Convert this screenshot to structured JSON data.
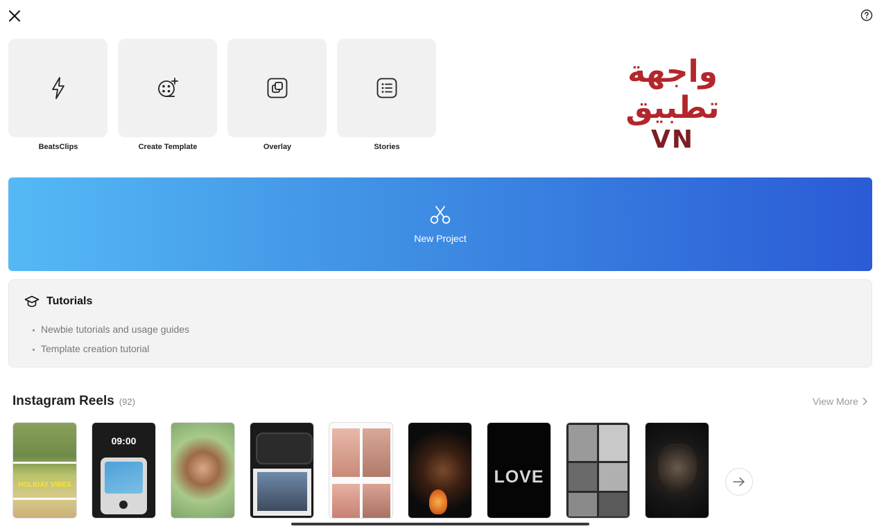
{
  "tiles": [
    {
      "label": "BeatsClips",
      "icon": "lightning-icon"
    },
    {
      "label": "Create Template",
      "icon": "film-reel-plus-icon"
    },
    {
      "label": "Overlay",
      "icon": "overlay-layers-icon"
    },
    {
      "label": "Stories",
      "icon": "list-icon"
    }
  ],
  "brand": {
    "arabic": "واجهة تطبيق",
    "latin": "VN"
  },
  "new_project": {
    "label": "New Project",
    "icon": "scissors-icon"
  },
  "tutorials": {
    "title": "Tutorials",
    "icon": "graduation-cap-icon",
    "items": [
      "Newbie tutorials and usage guides",
      "Template creation tutorial"
    ]
  },
  "reels": {
    "title": "Instagram Reels",
    "count": "(92)",
    "view_more": "View More",
    "thumb_texts": {
      "holiday": "HOLIDAY VIBES",
      "time": "09:00",
      "love": "LOVE"
    }
  },
  "colors": {
    "accent_start": "#55b9f5",
    "accent_end": "#2a5bd6",
    "brand_red": "#b3262c"
  }
}
